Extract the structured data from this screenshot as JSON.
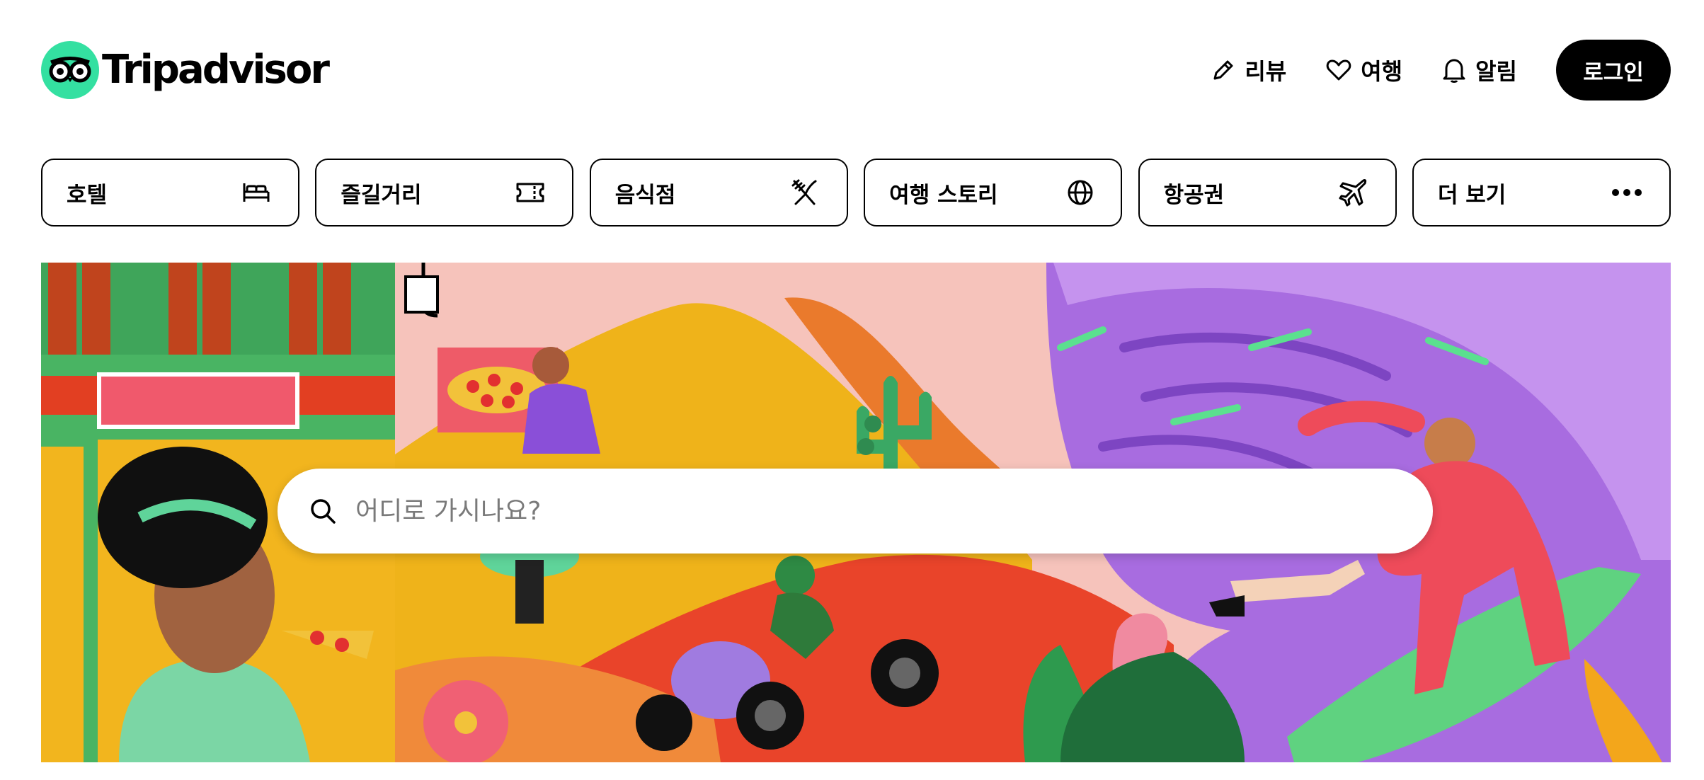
{
  "header": {
    "logo_text": "Tripadvisor",
    "nav": [
      {
        "label": "리뷰",
        "icon": "pencil-icon"
      },
      {
        "label": "여행",
        "icon": "heart-icon"
      },
      {
        "label": "알림",
        "icon": "bell-icon"
      }
    ],
    "login_label": "로그인"
  },
  "categories": [
    {
      "label": "호텔",
      "icon": "bed-icon"
    },
    {
      "label": "즐길거리",
      "icon": "ticket-icon"
    },
    {
      "label": "음식점",
      "icon": "fork-knife-icon"
    },
    {
      "label": "여행 스토리",
      "icon": "globe-icon"
    },
    {
      "label": "항공권",
      "icon": "airplane-icon"
    },
    {
      "label": "더 보기",
      "icon": "more-dots-icon"
    }
  ],
  "search": {
    "placeholder": "어디로 가시나요?"
  },
  "colors": {
    "brand_green": "#34e0a1",
    "black": "#000000"
  }
}
